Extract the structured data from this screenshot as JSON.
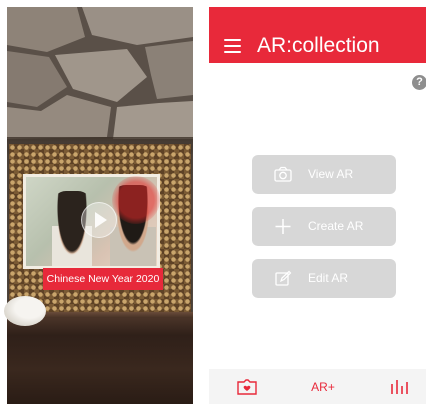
{
  "camera": {
    "caption": "Chinese New Year 2020",
    "play_icon": "play-icon"
  },
  "app": {
    "header": {
      "title": "AR:collection",
      "menu_icon": "hamburger-menu-icon",
      "color": "#e8293a"
    },
    "help": {
      "icon": "help-icon",
      "glyph": "?"
    },
    "actions": [
      {
        "icon": "camera-icon",
        "label": "View AR"
      },
      {
        "icon": "plus-icon",
        "label": "Create AR"
      },
      {
        "icon": "edit-icon",
        "label": "Edit AR"
      }
    ],
    "tabs": [
      {
        "icon": "home-gallery-icon",
        "label": ""
      },
      {
        "icon": "ar-plus-icon",
        "label": "AR+"
      },
      {
        "icon": "stats-icon",
        "label": ""
      }
    ],
    "colors": {
      "accent": "#e8293a",
      "button": "#d7d7d7",
      "tabbar": "#f4f4f4"
    }
  }
}
